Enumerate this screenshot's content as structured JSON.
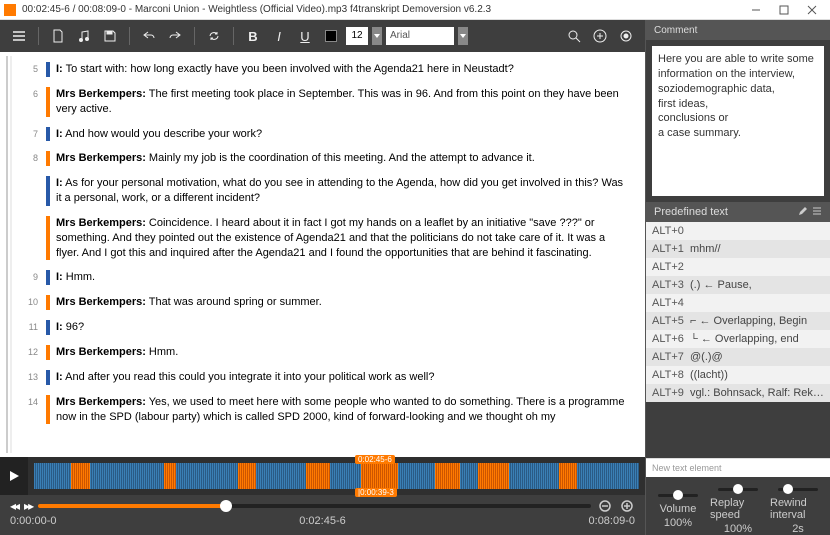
{
  "window": {
    "title": "00:02:45-6 / 00:08:09-0 - Marconi Union - Weightless (Official Video).mp3 f4transkript Demoversion v6.2.3"
  },
  "toolbar": {
    "font_size": "12",
    "font_family": "Arial"
  },
  "transcript": [
    {
      "n": "5",
      "role": "i",
      "speaker": "I:",
      "text": " To start with: how long exactly have you been involved with the Agenda21 here in Neustadt?"
    },
    {
      "n": "6",
      "role": "r",
      "speaker": "Mrs Berkempers:",
      "text": " The first meeting took place in September. This was in 96. And from this point on they have been very active."
    },
    {
      "n": "7",
      "role": "i",
      "speaker": "I:",
      "text": " And how would you describe your work?"
    },
    {
      "n": "8",
      "role": "r",
      "speaker": "Mrs Berkempers:",
      "text": " Mainly my job is the coordination of this meeting. And the attempt to advance it."
    },
    {
      "n": "",
      "role": "i",
      "speaker": "I:",
      "text": " As for your personal motivation, what do you see in attending to the Agenda, how did you get involved in this? Was it a personal, work, or a different incident?"
    },
    {
      "n": "",
      "role": "r",
      "speaker": "Mrs Berkempers:",
      "text": " Coincidence. I heard about it in fact I got my hands on a leaflet by an initiative \"save ???\" or something. And they pointed out the existence of Agenda21 and that the politicians do not take care of it. It was a flyer. And I got this and inquired after the Agenda21 and I found the opportunities that are behind it fascinating."
    },
    {
      "n": "9",
      "role": "i",
      "speaker": "I:",
      "text": " Hmm."
    },
    {
      "n": "10",
      "role": "r",
      "speaker": "Mrs Berkempers:",
      "text": " That was around spring or summer."
    },
    {
      "n": "11",
      "role": "i",
      "speaker": "I:",
      "text": " 96?"
    },
    {
      "n": "12",
      "role": "r",
      "speaker": "Mrs Berkempers:",
      "text": " Hmm."
    },
    {
      "n": "13",
      "role": "i",
      "speaker": "I:",
      "text": " And after you read this could you integrate it into your political work as well?"
    },
    {
      "n": "14",
      "role": "r",
      "speaker": "Mrs Berkempers:",
      "text": " Yes, we used to meet here with some people who wanted to do something. There is a programme now in the SPD (labour party) which is called SPD 2000, kind of forward-looking and we thought oh my"
    }
  ],
  "wave": {
    "marker_top": "0:02:45-6",
    "marker_bottom": "|0:00:39-3"
  },
  "transport": {
    "start": "0:00:00-0",
    "current": "0:02:45-6",
    "end": "0:08:09-0",
    "progress_pct": 34
  },
  "comment": {
    "header": "Comment",
    "line1": "Here you are able to write some information on the interview,",
    "line2": "soziodemographic data,",
    "line3": "first ideas,",
    "line4": "conclusions or",
    "line5": "a case summary."
  },
  "predef": {
    "header": "Predefined text",
    "items": [
      {
        "k": "ALT+0",
        "v": ""
      },
      {
        "k": "ALT+1",
        "v": "mhm//"
      },
      {
        "k": "ALT+2",
        "v": ""
      },
      {
        "k": "ALT+3",
        "v": "(.) ← Pause,"
      },
      {
        "k": "ALT+4",
        "v": ""
      },
      {
        "k": "ALT+5",
        "v": "⌐ ← Overlapping, Begin"
      },
      {
        "k": "ALT+6",
        "v": "└ ← Overlapping, end"
      },
      {
        "k": "ALT+7",
        "v": "@(.)@"
      },
      {
        "k": "ALT+8",
        "v": "((lacht))"
      },
      {
        "k": "ALT+9",
        "v": "vgl.: Bohnsack, Ralf: Rekonstruktive Soz"
      }
    ],
    "new_elem": "New text element"
  },
  "controls": {
    "volume_label": "Volume",
    "volume_value": "100%",
    "speed_label": "Replay speed",
    "speed_value": "100%",
    "rewind_label": "Rewind interval",
    "rewind_value": "2s"
  }
}
